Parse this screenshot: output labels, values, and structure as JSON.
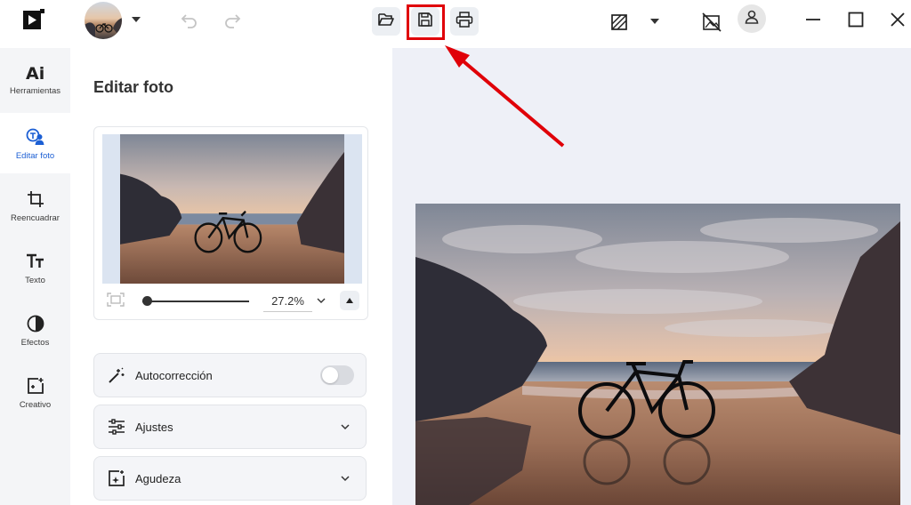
{
  "toolbar": {
    "icons": [
      "app-logo-icon",
      "avatar",
      "chevron-down-icon",
      "undo-icon",
      "redo-icon",
      "folder-open-icon",
      "save-icon",
      "print-icon",
      "compare-icon",
      "chevron-down-icon",
      "no-image-icon",
      "user-icon",
      "minimize-icon",
      "maximize-icon",
      "close-icon"
    ],
    "highlight_color": "#e00008"
  },
  "sidebar": {
    "items": [
      {
        "label": "Herramientas",
        "icon": "ai-icon",
        "active": false
      },
      {
        "label": "Editar foto",
        "icon": "edit-photo-icon",
        "active": true
      },
      {
        "label": "Reencuadrar",
        "icon": "crop-icon",
        "active": false
      },
      {
        "label": "Texto",
        "icon": "text-icon",
        "active": false
      },
      {
        "label": "Efectos",
        "icon": "effects-icon",
        "active": false
      },
      {
        "label": "Creativo",
        "icon": "creative-icon",
        "active": false
      }
    ],
    "accent_color": "#1c5fd4"
  },
  "panel": {
    "title": "Editar foto",
    "zoom": "27.2%",
    "sections": [
      {
        "label": "Autocorrección",
        "icon": "magic-wand-icon",
        "control": "toggle",
        "on": false
      },
      {
        "label": "Ajustes",
        "icon": "sliders-icon",
        "control": "chevron"
      },
      {
        "label": "Agudeza",
        "icon": "sharpen-icon",
        "control": "chevron"
      }
    ]
  }
}
